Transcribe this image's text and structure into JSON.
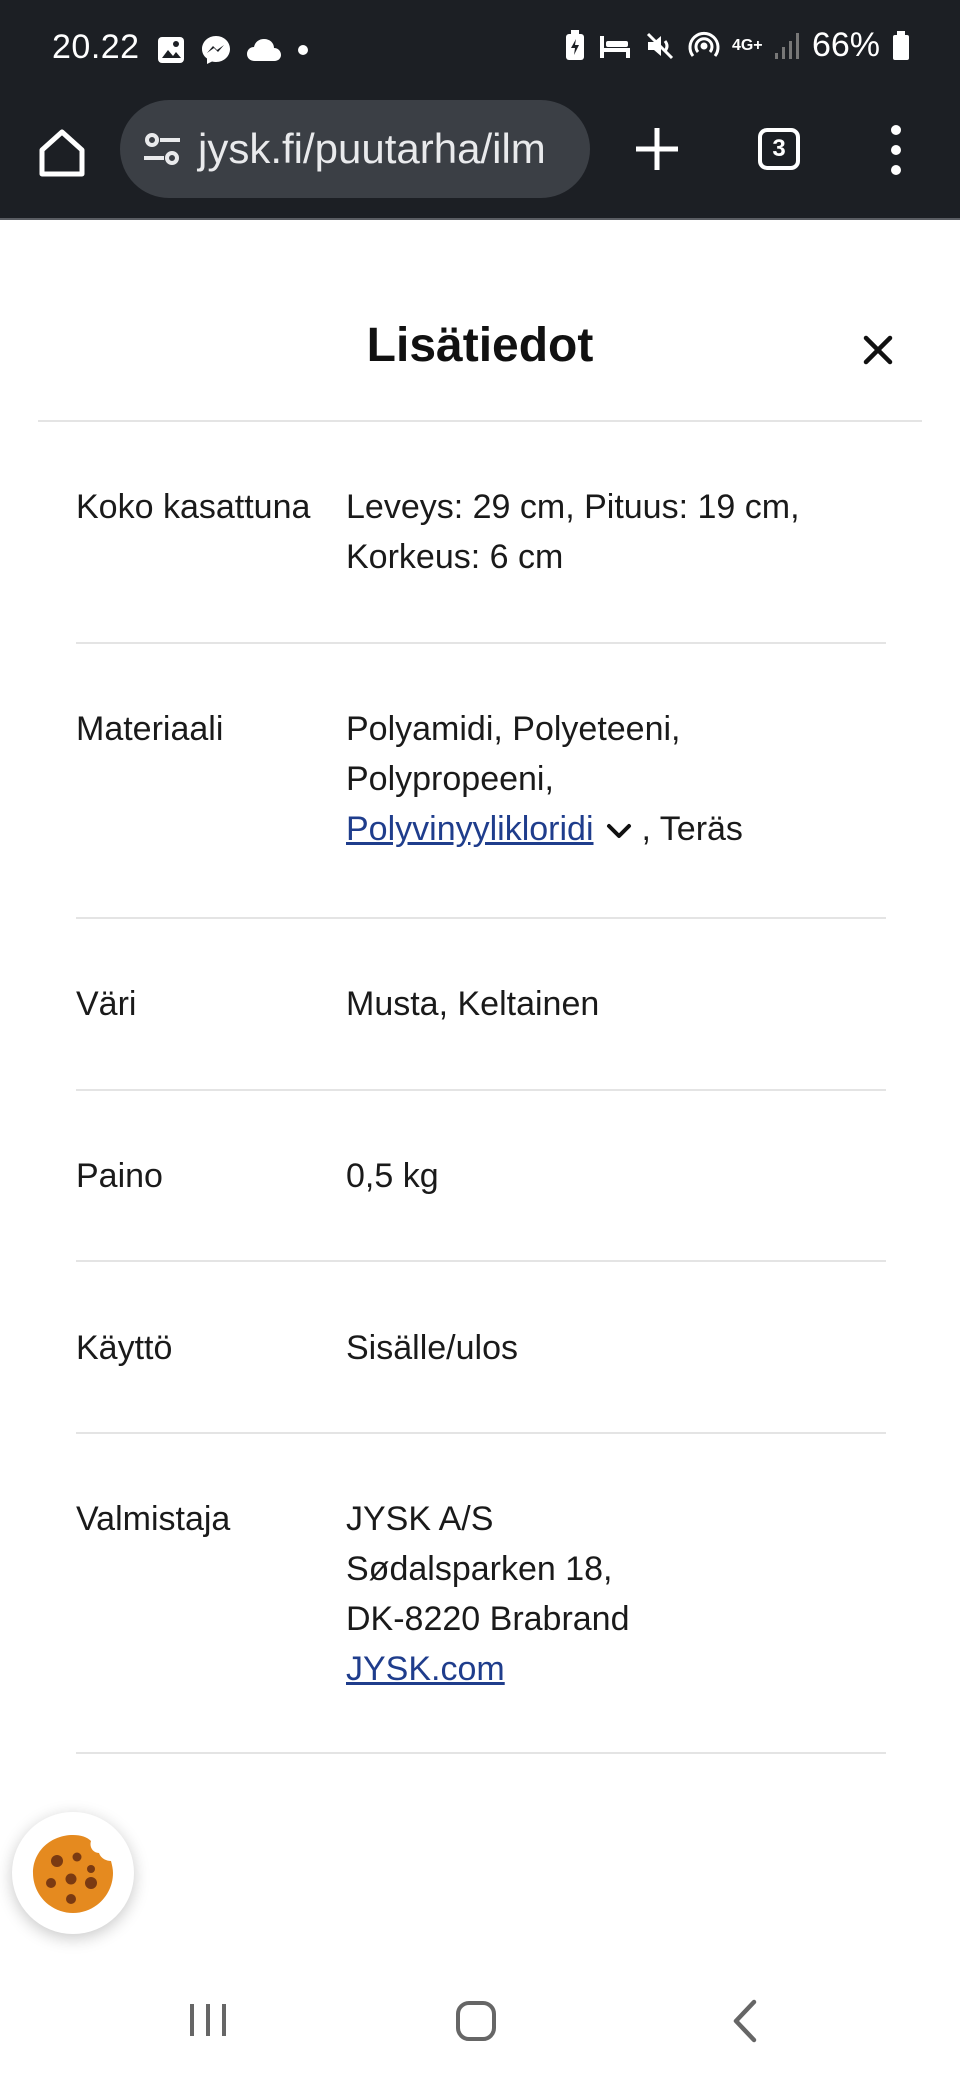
{
  "status_bar": {
    "time": "20.22",
    "network_label": "4G+",
    "battery": "66%"
  },
  "browser": {
    "url": "jysk.fi/puutarha/ilm",
    "tab_count": "3"
  },
  "panel": {
    "title": "Lisätiedot",
    "close_icon": "close-icon",
    "rows": [
      {
        "label": "Koko kasattuna",
        "value_lines": [
          "Leveys: 29 cm, Pituus: 19 cm,",
          "Korkeus: 6 cm"
        ]
      },
      {
        "label": "Materiaali",
        "value_lines": [
          "Polyamidi, Polyeteeni,",
          "Polypropeeni,"
        ],
        "link": "Polyvinyylikloridi",
        "after_link": ", Teräs"
      },
      {
        "label": "Väri",
        "value_lines": [
          "Musta, Keltainen"
        ]
      },
      {
        "label": "Paino",
        "value_lines": [
          "0,5 kg"
        ]
      },
      {
        "label": "Käyttö",
        "value_lines": [
          "Sisälle/ulos"
        ]
      },
      {
        "label": "Valmistaja",
        "value_lines": [
          "JYSK A/S",
          "Sødalsparken 18,",
          "DK-8220 Brabrand"
        ],
        "link": "JYSK.com"
      }
    ]
  },
  "colors": {
    "chrome_bg": "#1c1f24",
    "urlbar_bg": "#3b3f45",
    "link": "#1f3d8c",
    "divider": "#e4e4e4",
    "cookie": "#e58a1f"
  },
  "icons": {
    "home": "home-icon",
    "site_settings": "tune-icon",
    "new_tab": "plus-icon",
    "menu": "more-vert-icon",
    "cookie": "cookie-icon",
    "nav_recents": "recents-icon",
    "nav_home": "nav-home-icon",
    "nav_back": "back-icon"
  }
}
